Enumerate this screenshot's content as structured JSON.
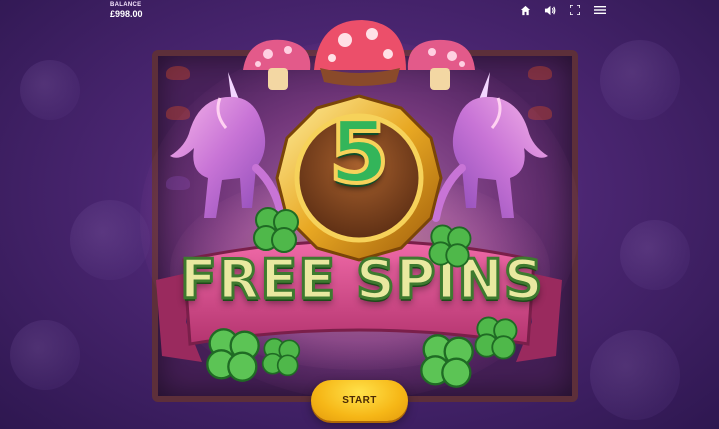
{
  "top_bar": {
    "balance_label": "BALANCE",
    "balance_value": "£998.00",
    "icons": [
      "home-icon",
      "sound-icon",
      "fullscreen-icon",
      "menu-icon"
    ]
  },
  "feature_award": {
    "count": "5",
    "title": "FREE SPINS"
  },
  "actions": {
    "start_label": "START"
  },
  "colors": {
    "background": "#4b2672",
    "start_button": "#f6b717",
    "number_green": "#33b55a",
    "ribbon_pink": "#d9488f",
    "gold": "#f6d25a"
  }
}
